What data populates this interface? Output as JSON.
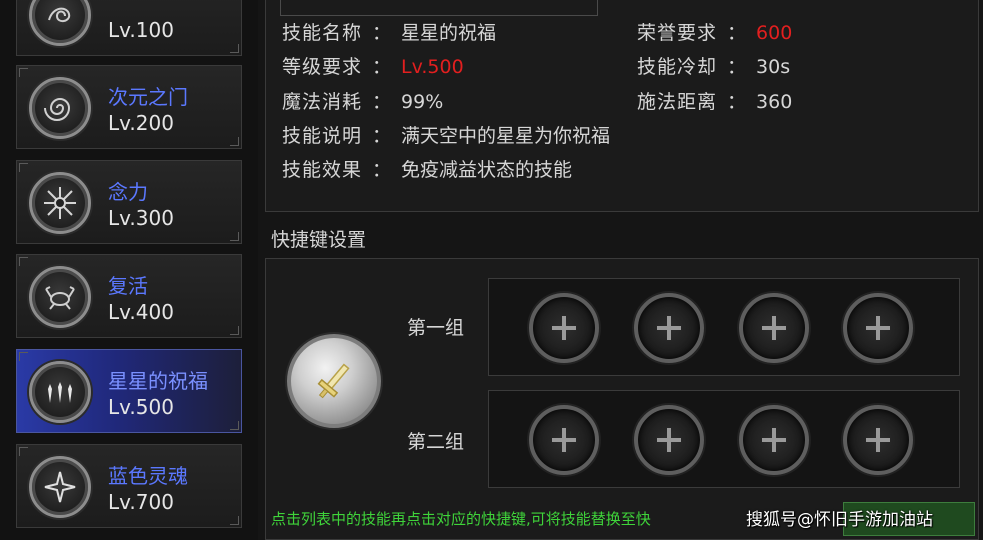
{
  "skills": [
    {
      "name": "",
      "level": "Lv.100",
      "icon": "swirl-rune-icon"
    },
    {
      "name": "次元之门",
      "level": "Lv.200",
      "icon": "vortex-icon"
    },
    {
      "name": "念力",
      "level": "Lv.300",
      "icon": "spiked-burst-icon"
    },
    {
      "name": "复活",
      "level": "Lv.400",
      "icon": "crab-rune-icon"
    },
    {
      "name": "星星的祝福",
      "level": "Lv.500",
      "icon": "triple-star-icon",
      "selected": true
    },
    {
      "name": "蓝色灵魂",
      "level": "Lv.700",
      "icon": "four-point-star-icon"
    }
  ],
  "info": {
    "skill_name_label": "技能名称",
    "skill_name": "星星的祝福",
    "honor_label": "荣誉要求",
    "honor_value": "600",
    "level_req_label": "等级要求",
    "level_req_value": "Lv.500",
    "cooldown_label": "技能冷却",
    "cooldown_value": "30s",
    "mana_label": "魔法消耗",
    "mana_value": "99%",
    "range_label": "施法距离",
    "range_value": "360",
    "desc_label": "技能说明",
    "desc_value": "满天空中的星星为你祝福",
    "effect_label": "技能效果",
    "effect_value": "免疫减益状态的技能",
    "separator": "："
  },
  "shortcut": {
    "title": "快捷键设置",
    "group1_label": "第一组",
    "group2_label": "第二组",
    "hint": "点击列表中的技能再点击对应的快捷键,可将技能替换至快",
    "current_icon": "sword-icon"
  },
  "watermark": "搜狐号@怀旧手游加油站",
  "colors": {
    "skill_name": "#5b78ff",
    "red_value": "#e21f1f",
    "hint": "#3fd43a",
    "selected_bg": "#2a3aa6"
  }
}
